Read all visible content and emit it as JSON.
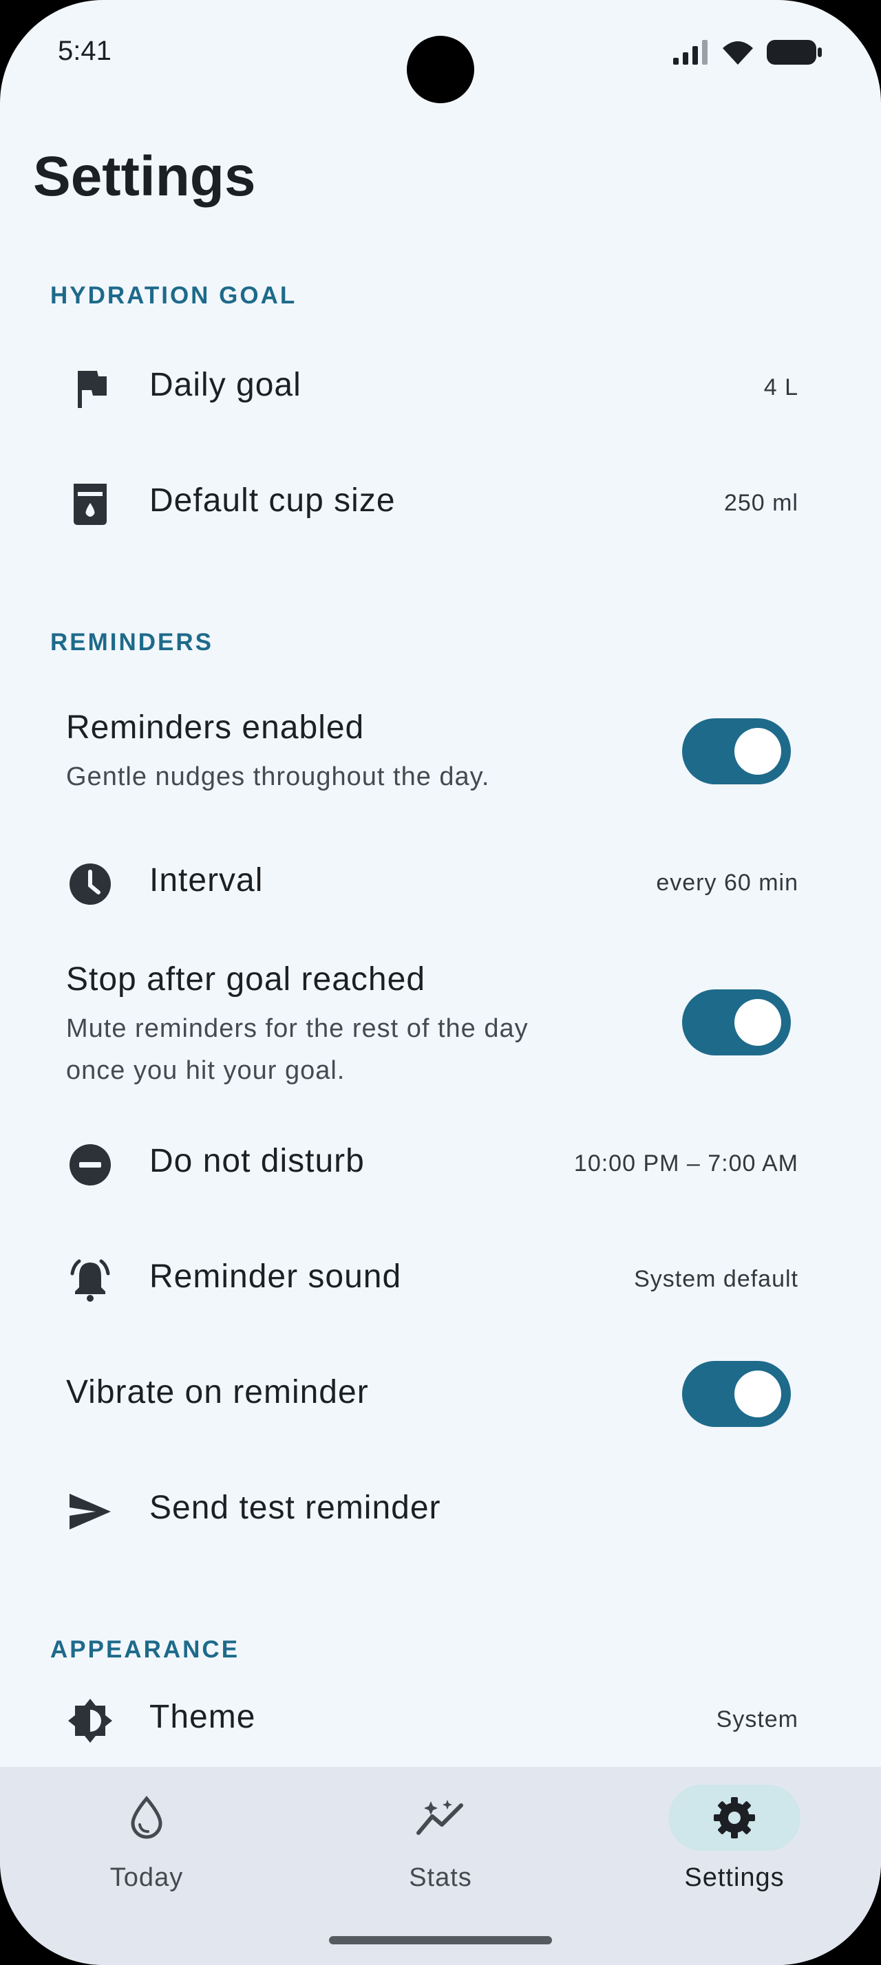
{
  "status_bar": {
    "time": "5:41"
  },
  "page": {
    "title": "Settings"
  },
  "sections": {
    "hydration": {
      "heading": "HYDRATION GOAL"
    },
    "reminders": {
      "heading": "REMINDERS"
    },
    "appearance": {
      "heading": "APPEARANCE"
    }
  },
  "settings": {
    "daily_goal": {
      "label": "Daily goal",
      "value": "4 L",
      "icon": "flag-icon"
    },
    "cup_size": {
      "label": "Default cup size",
      "value": "250 ml",
      "icon": "cup-icon"
    },
    "reminders_enabled": {
      "label": "Reminders enabled",
      "subtitle": "Gentle nudges throughout the day.",
      "on": true
    },
    "interval": {
      "label": "Interval",
      "value": "every 60 min",
      "icon": "clock-icon"
    },
    "stop_after_goal": {
      "label": "Stop after goal reached",
      "subtitle_line1": "Mute reminders for the rest of the day",
      "subtitle_line2": "once you hit your goal.",
      "on": true
    },
    "dnd": {
      "label": "Do not disturb",
      "value": "10:00 PM – 7:00 AM",
      "icon": "do-not-disturb-icon"
    },
    "sound": {
      "label": "Reminder sound",
      "value": "System default",
      "icon": "bell-icon"
    },
    "vibrate": {
      "label": "Vibrate on reminder",
      "on": true
    },
    "test": {
      "label": "Send test reminder",
      "icon": "send-icon"
    },
    "theme": {
      "label": "Theme",
      "value": "System",
      "icon": "theme-icon"
    }
  },
  "nav": {
    "items": [
      {
        "label": "Today",
        "icon": "water-drop-icon",
        "active": false
      },
      {
        "label": "Stats",
        "icon": "stats-icon",
        "active": false
      },
      {
        "label": "Settings",
        "icon": "gear-icon",
        "active": true
      }
    ]
  },
  "colors": {
    "accent": "#1e6a8a",
    "background": "#f2f7fc",
    "nav_background": "#e2e7ef",
    "active_pill": "#cfe6ea"
  }
}
